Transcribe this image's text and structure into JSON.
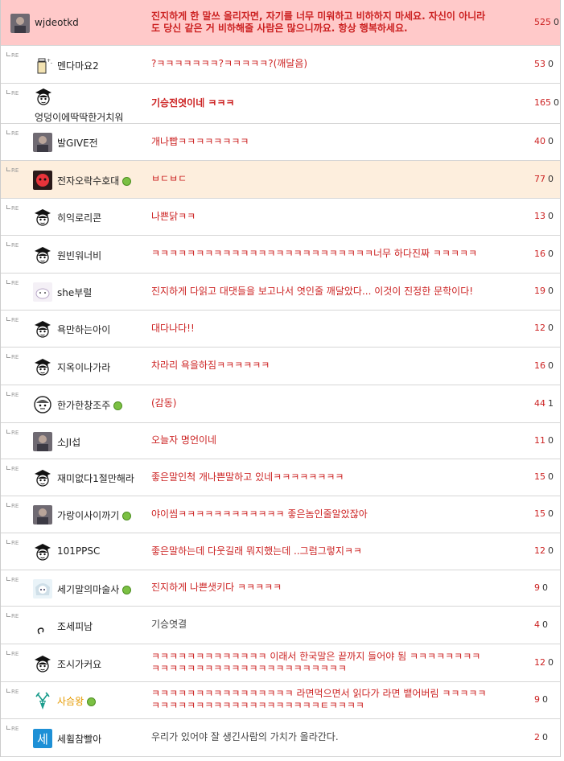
{
  "reply_tag": "RE",
  "comments": [
    {
      "nick": "wjdeotkd",
      "text": "진지하게 한 말쓰 올리자면, 자기를 너무 미워하고 비하하지 마세요. 자신이 아니라도 당신 같은 거 비하해줄 사람은 많으니까요. 항상 행복하세요.",
      "likes": "525",
      "dislikes": "0",
      "icon": "photo-avatar",
      "reply": false,
      "style": "best",
      "bold": true
    },
    {
      "nick": "멘다마요2",
      "text": "?ㅋㅋㅋㅋㅋㅋㅋ?ㅋㅋㅋㅋㅋ?(깨달음)",
      "likes": "53",
      "dislikes": "0",
      "icon": "bottle-icon",
      "reply": true
    },
    {
      "nick": "엉덩이에딱딱한거치워",
      "text": "기승전엿이네 ㅋㅋㅋ",
      "likes": "165",
      "dislikes": "0",
      "icon": "grad-cap-icon",
      "reply": true,
      "bold": true
    },
    {
      "nick": "발GIVE전",
      "text": "개나빱ㅋㅋㅋㅋㅋㅋㅋㅋ",
      "likes": "40",
      "dislikes": "0",
      "icon": "photo-avatar",
      "reply": true
    },
    {
      "nick": "전자오락수호대",
      "text": "ㅂㄷㅂㄷ",
      "likes": "77",
      "dislikes": "0",
      "icon": "red-face-avatar",
      "reply": true,
      "style": "orange",
      "online": true
    },
    {
      "nick": "히익로리콘",
      "text": "나쁜닭ㅋㅋ",
      "likes": "13",
      "dislikes": "0",
      "icon": "grad-cap-icon",
      "reply": true
    },
    {
      "nick": "원빈워너비",
      "text": "ㅋㅋㅋㅋㅋㅋㅋㅋㅋㅋㅋㅋㅋㅋㅋㅋㅋㅋㅋㅋㅋㅋㅋㅋㅋ너무 하다진짜 ㅋㅋㅋㅋㅋ",
      "likes": "16",
      "dislikes": "0",
      "icon": "grad-cap-icon",
      "reply": true
    },
    {
      "nick": "she부럴",
      "text": "진지하게 다읽고 대댓들을 보고나서 엿인줄 깨달았다... 이것이 진정한 문학이다!",
      "likes": "19",
      "dislikes": "0",
      "icon": "cat-avatar",
      "reply": true
    },
    {
      "nick": "욕만하는아이",
      "text": "대다나다!!",
      "likes": "12",
      "dislikes": "0",
      "icon": "grad-cap-icon",
      "reply": true
    },
    {
      "nick": "지옥이나가라",
      "text": "차라리 욕을하짐ㅋㅋㅋㅋㅋㅋ",
      "likes": "16",
      "dislikes": "0",
      "icon": "grad-cap-icon",
      "reply": true
    },
    {
      "nick": "한가한창조주",
      "text": "(감동)",
      "likes": "44",
      "dislikes": "1",
      "icon": "face-outline-icon",
      "reply": true,
      "online": true
    },
    {
      "nick": "소JI섭",
      "text": "오늘자 명언이네",
      "likes": "11",
      "dislikes": "0",
      "icon": "photo-avatar",
      "reply": true
    },
    {
      "nick": "재미없다1절만해라",
      "text": "좋은말인척 개나쁜말하고 있네ㅋㅋㅋㅋㅋㅋㅋㅋ",
      "likes": "15",
      "dislikes": "0",
      "icon": "grad-cap-icon",
      "reply": true
    },
    {
      "nick": "가랑이사이까기",
      "text": "야이씸ㅋㅋㅋㅋㅋㅋㅋㅋㅋㅋㅋㅋ 좋은놈인줄알았잖아",
      "likes": "15",
      "dislikes": "0",
      "icon": "photo-avatar",
      "reply": true,
      "online": true
    },
    {
      "nick": "101PPSC",
      "text": "좋은말하는데 다웃길래 뭐지했는데 ..그럼그렇지ㅋㅋ",
      "likes": "12",
      "dislikes": "0",
      "icon": "grad-cap-icon",
      "reply": true
    },
    {
      "nick": "세기말의마술사",
      "text": "진지하게 나쁜샛키다 ㅋㅋㅋㅋㅋ",
      "likes": "9",
      "dislikes": "0",
      "icon": "anime-avatar",
      "reply": true,
      "online": true
    },
    {
      "nick": "조세피남",
      "text": "기승엿결",
      "likes": "4",
      "dislikes": "0",
      "icon": "swirl-icon",
      "reply": true,
      "gray": true
    },
    {
      "nick": "조시가커요",
      "text": "ㅋㅋㅋㅋㅋㅋㅋㅋㅋㅋㅋㅋㅋ 이래서 한국말은 끝까지 들어야 됨 ㅋㅋㅋㅋㅋㅋㅋㅋㅋㅋㅋㅋㅋㅋㅋㅋㅋㅋㅋㅋㅋㅋㅋㅋㅋㅋㅋㅋㅋㅋ",
      "likes": "12",
      "dislikes": "0",
      "icon": "grad-cap-icon",
      "reply": true
    },
    {
      "nick": "사슴왕",
      "text": "ㅋㅋㅋㅋㅋㅋㅋㅋㅋㅋㅋㅋㅋㅋㅋㅋ 라면먹으면서 읽다가 라면 뱉어버림 ㅋㅋㅋㅋㅋㅋㅋㅋㅋㅋㅋㅋㅋㅋㅋㅋㅋㅋㅋㅋㅋㅋㅋㅋㅌㅋㅋㅋㅋ",
      "likes": "9",
      "dislikes": "0",
      "icon": "deer-icon",
      "reply": true,
      "online": true,
      "gold": true
    },
    {
      "nick": "세휠참빨아",
      "text": "우리가 있어야 잘 생긴사람의 가치가 올라간다.",
      "likes": "2",
      "dislikes": "0",
      "icon": "blue-sae-icon",
      "reply": true,
      "gray": true
    }
  ],
  "colors": {
    "best_bg": "#ffc9c9",
    "orange_bg": "#fdeedd",
    "text_red": "#cc2222",
    "online_green": "#7bc043"
  }
}
